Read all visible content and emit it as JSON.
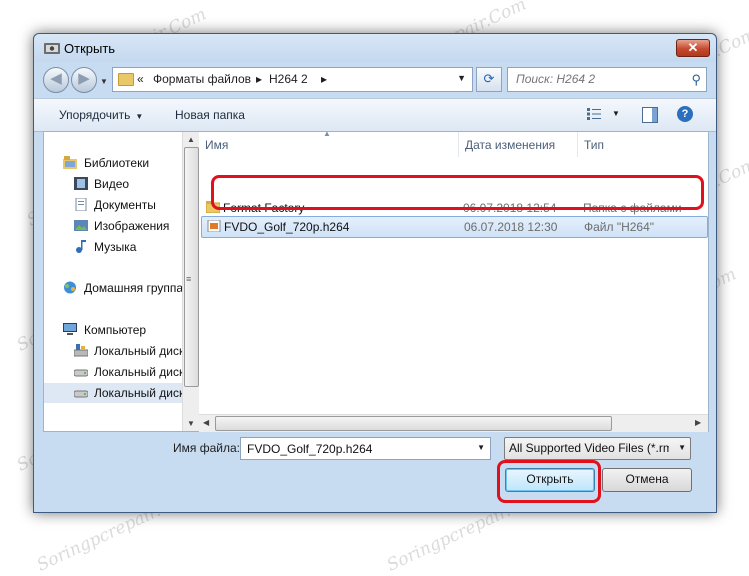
{
  "window": {
    "title": "Открыть",
    "close_symbol": "✕"
  },
  "navigation": {
    "back_symbol": "◀",
    "forward_symbol": "▶",
    "breadcrumb_sep": "«",
    "breadcrumbs": [
      "Форматы файлов",
      "H264 2"
    ],
    "crumb_arrow": "▸",
    "refresh_symbol": "⟳",
    "search": {
      "placeholder": "Поиск: H264 2"
    }
  },
  "toolbar": {
    "organize_label": "Упорядочить",
    "new_folder_label": "Новая папка",
    "help_symbol": "?"
  },
  "nav_pane": {
    "items": [
      {
        "label": "Библиотеки",
        "icon": "libraries-icon"
      },
      {
        "label": "Видео",
        "icon": "video-icon"
      },
      {
        "label": "Документы",
        "icon": "documents-icon"
      },
      {
        "label": "Изображения",
        "icon": "images-icon"
      },
      {
        "label": "Музыка",
        "icon": "music-icon"
      },
      {
        "label": "Домашняя группа",
        "icon": "homegroup-icon"
      },
      {
        "label": "Компьютер",
        "icon": "computer-icon"
      },
      {
        "label": "Локальный диск",
        "icon": "drive-icon"
      },
      {
        "label": "Локальный диск",
        "icon": "drive-icon"
      },
      {
        "label": "Локальный диск",
        "icon": "drive-icon",
        "selected": true
      }
    ]
  },
  "file_list": {
    "columns": [
      "Имя",
      "Дата изменения",
      "Тип"
    ],
    "rows": [
      {
        "name": "Format Factory",
        "date": "06.07.2018 12:54",
        "type": "Папка с файлами",
        "icon": "folder-icon"
      },
      {
        "name": "FVDO_Golf_720p.h264",
        "date": "06.07.2018 12:30",
        "type": "Файл \"H264\"",
        "icon": "video-file-icon",
        "selected": true
      }
    ]
  },
  "footer": {
    "filename_label": "Имя файла:",
    "filename_value": "FVDO_Golf_720p.h264",
    "filter_value": "All Supported Video Files (*.rm;",
    "open_label": "Открыть",
    "cancel_label": "Отмена"
  },
  "watermark": "Soringpcrepair.Com",
  "colors": {
    "highlight": "#e0101c",
    "accent": "#2c6fbe"
  }
}
